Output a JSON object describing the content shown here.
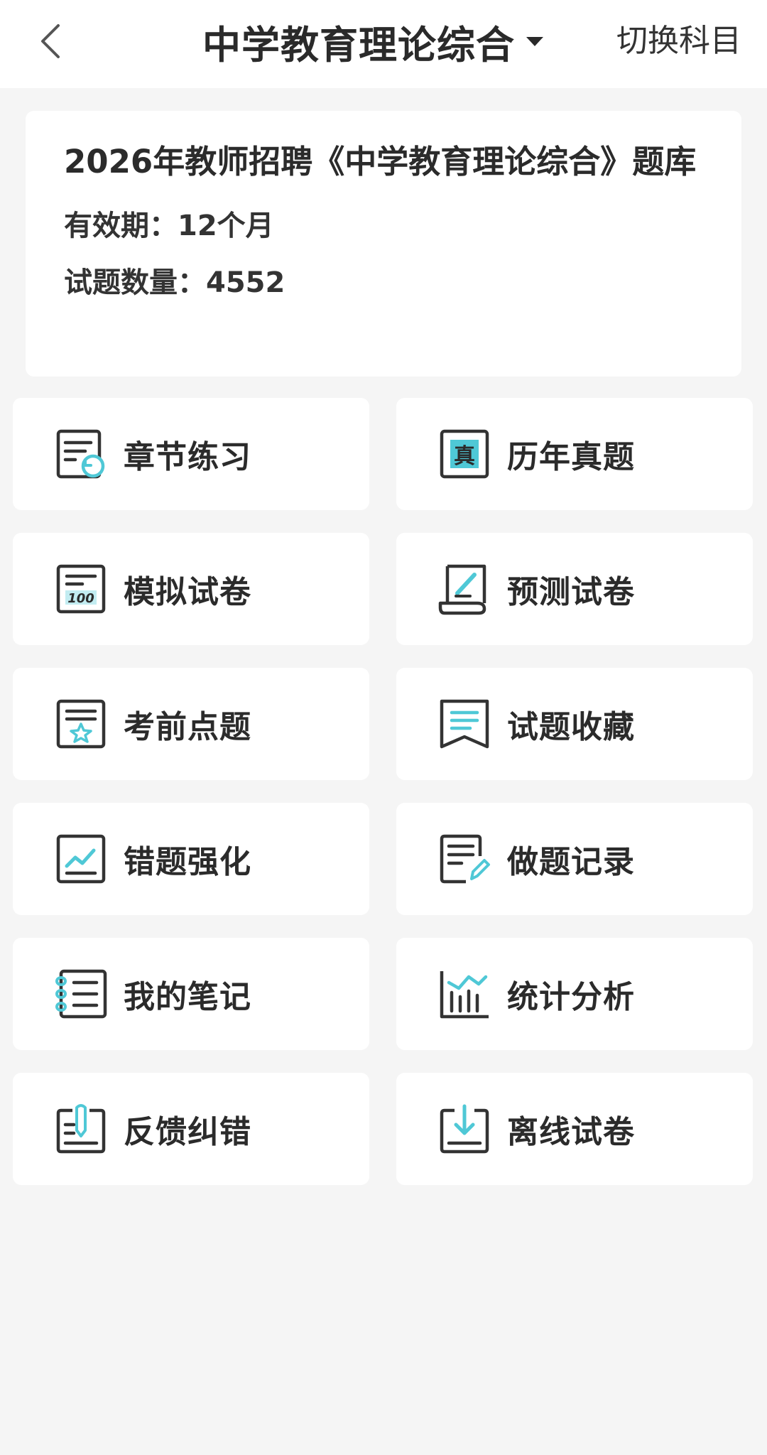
{
  "header": {
    "title": "中学教育理论综合",
    "switch_label": "切换科目"
  },
  "info": {
    "title": "2026年教师招聘《中学教育理论综合》题库",
    "validity": "有效期：12个月",
    "count": "试题数量：4552"
  },
  "colors": {
    "accent": "#4fc8d6",
    "icon_stroke": "#333333",
    "background": "#f5f5f5"
  },
  "tiles": [
    {
      "label": "章节练习",
      "icon": "chapter-practice-icon"
    },
    {
      "label": "历年真题",
      "icon": "past-exams-icon"
    },
    {
      "label": "模拟试卷",
      "icon": "mock-paper-icon"
    },
    {
      "label": "预测试卷",
      "icon": "prediction-paper-icon"
    },
    {
      "label": "考前点题",
      "icon": "pre-exam-tips-icon"
    },
    {
      "label": "试题收藏",
      "icon": "favorites-icon"
    },
    {
      "label": "错题强化",
      "icon": "wrong-questions-icon"
    },
    {
      "label": "做题记录",
      "icon": "practice-record-icon"
    },
    {
      "label": "我的笔记",
      "icon": "notes-icon"
    },
    {
      "label": "统计分析",
      "icon": "statistics-icon"
    },
    {
      "label": "反馈纠错",
      "icon": "feedback-icon"
    },
    {
      "label": "离线试卷",
      "icon": "offline-download-icon"
    }
  ]
}
